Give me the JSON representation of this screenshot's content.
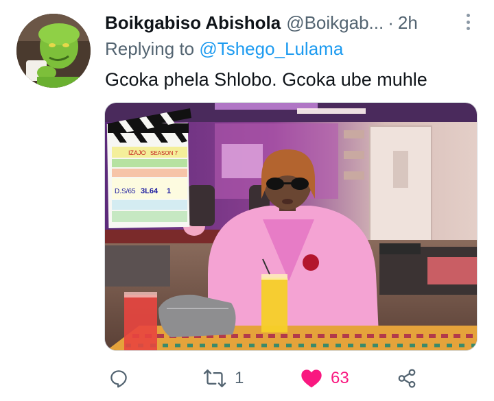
{
  "tweet": {
    "display_name": "Boikgabiso Abishola",
    "handle": "@Boikgab...",
    "separator": "·",
    "time": "2h",
    "replying_prefix": "Replying to ",
    "replying_to": "@Tshego_Lulama",
    "text": "Gcoka phela Shlobo. Gcoka ube muhle"
  },
  "clapperboard": {
    "production": "IZAJO",
    "season": "SEASON 7",
    "scene": "3L64",
    "take": "1",
    "date": "D.S/65"
  },
  "actions": {
    "reply_icon": "reply-icon",
    "retweet_icon": "retweet-icon",
    "retweet_count": "1",
    "like_icon": "heart-icon",
    "like_count": "63",
    "share_icon": "share-icon"
  },
  "colors": {
    "link": "#1d9bf0",
    "secondary_text": "#536471",
    "like": "#f91880"
  }
}
